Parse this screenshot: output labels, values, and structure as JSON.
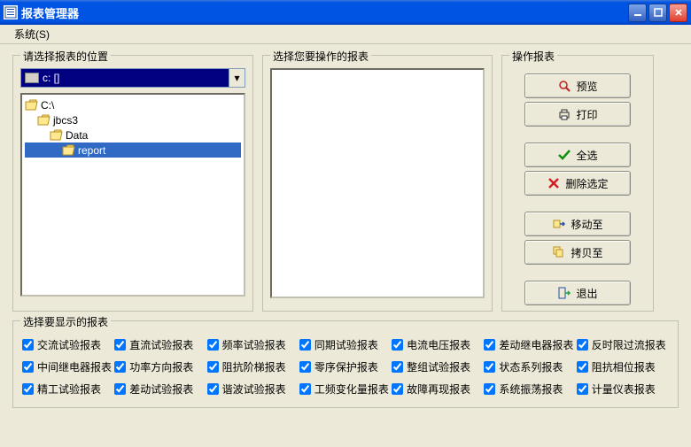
{
  "window": {
    "title": "报表管理器"
  },
  "menu": {
    "system": "系统(S)"
  },
  "groups": {
    "location": "请选择报表的位置",
    "select": "选择您要操作的报表",
    "actions": "操作报表",
    "display": "选择要显示的报表"
  },
  "drive": {
    "label": "c: []"
  },
  "tree": {
    "n0": "C:\\",
    "n1": "jbcs3",
    "n2": "Data",
    "n3": "report"
  },
  "buttons": {
    "preview": "预览",
    "print": "打印",
    "selectAll": "全选",
    "deleteSel": "删除选定",
    "moveTo": "移动至",
    "copyTo": "拷贝至",
    "exit": "退出"
  },
  "checks": {
    "c00": "交流试验报表",
    "c01": "直流试验报表",
    "c02": "频率试验报表",
    "c03": "同期试验报表",
    "c04": "电流电压报表",
    "c05": "差动继电器报表",
    "c06": "反时限过流报表",
    "c10": "中间继电器报表",
    "c11": "功率方向报表",
    "c12": "阻抗阶梯报表",
    "c13": "零序保护报表",
    "c14": "整组试验报表",
    "c15": "状态系列报表",
    "c16": "阻抗相位报表",
    "c20": "精工试验报表",
    "c21": "差动试验报表",
    "c22": "谐波试验报表",
    "c23": "工频变化量报表",
    "c24": "故障再现报表",
    "c25": "系统振荡报表",
    "c26": "计量仪表报表"
  }
}
